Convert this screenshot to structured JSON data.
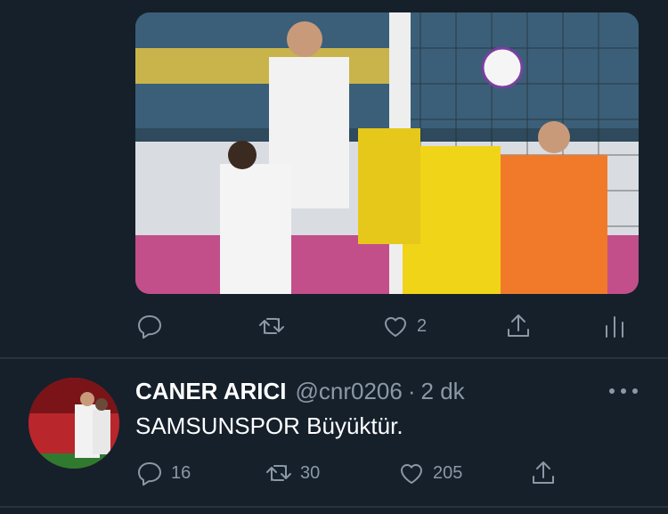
{
  "tweet1": {
    "media_alt": "",
    "actions": {
      "reply_count": "",
      "retweet_count": "",
      "like_count": "2",
      "share_label": "",
      "analytics_label": ""
    }
  },
  "tweet2": {
    "author_name": "CANER ARICI",
    "author_handle": "@cnr0206",
    "separator": "·",
    "time": "2 dk",
    "text": "SAMSUNSPOR Büyüktür.",
    "actions": {
      "reply_count": "16",
      "retweet_count": "30",
      "like_count": "205"
    }
  },
  "colors": {
    "background": "#15202b",
    "muted": "#8b98a5",
    "divider": "#2a333d",
    "text": "#ffffff"
  },
  "icons": [
    "reply-icon",
    "retweet-icon",
    "like-icon",
    "share-icon",
    "analytics-icon",
    "more-icon"
  ]
}
